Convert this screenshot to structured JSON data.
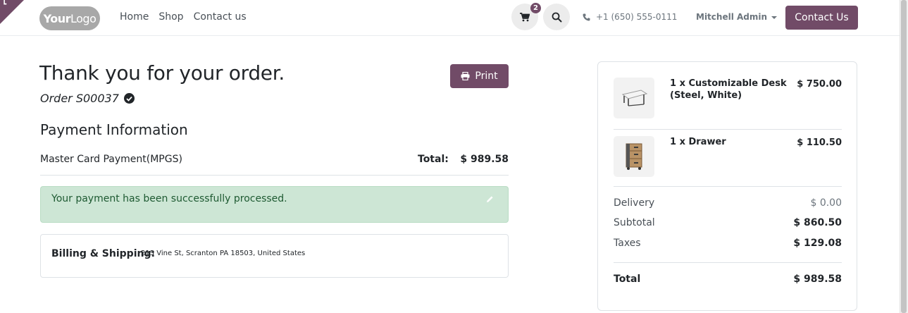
{
  "header": {
    "logo": {
      "part1": "Your",
      "part2": "Logo"
    },
    "nav": [
      "Home",
      "Shop",
      "Contact us"
    ],
    "cart_count": "2",
    "phone": "+1 (650) 555-0111",
    "user": "Mitchell Admin",
    "contact_button": "Contact Us",
    "icons": [
      "cart-icon",
      "search-icon",
      "phone-icon",
      "caret-down-icon"
    ]
  },
  "order": {
    "title": "Thank you for your order.",
    "order_label": "Order S00037",
    "print_label": "Print",
    "payment_heading": "Payment Information",
    "payment_method": "Master Card Payment(MPGS)",
    "total_label": "Total:",
    "total_value": "$ 989.58",
    "alert_text": "Your payment has been successfully processed.",
    "billing_label": "Billing & Shipping:",
    "billing_address": "215 Vine St, Scranton PA 18503, United States"
  },
  "summary": {
    "items": [
      {
        "name": "1 x Customizable Desk (Steel, White)",
        "price": "$ 750.00",
        "image_icon": "desk-icon"
      },
      {
        "name": "1 x Drawer",
        "price": "$ 110.50",
        "image_icon": "drawer-icon"
      }
    ],
    "delivery_label": "Delivery",
    "delivery_value": "$ 0.00",
    "subtotal_label": "Subtotal",
    "subtotal_value": "$ 860.50",
    "taxes_label": "Taxes",
    "taxes_value": "$ 129.08",
    "total_label": "Total",
    "total_value": "$ 989.58"
  },
  "colors": {
    "brand": "#714B67",
    "success_bg": "#cde6d5",
    "success_text": "#1e5a32"
  }
}
